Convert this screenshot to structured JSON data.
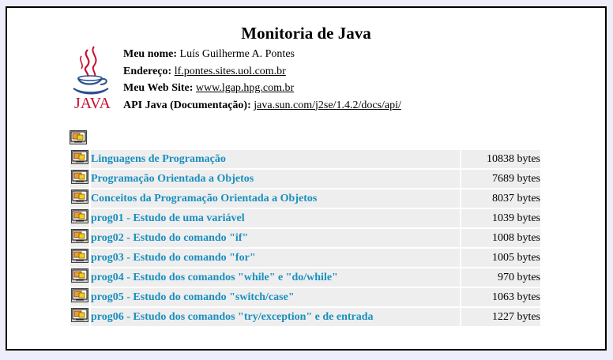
{
  "page": {
    "title": "Monitoria de Java"
  },
  "logo": {
    "word": "JAVA",
    "icon": "java-coffee-cup-logo"
  },
  "info": {
    "name_label": "Meu nome:",
    "name_value": "Luís Guilherme A. Pontes",
    "address_label": "Endereço:",
    "address_value": "lf.pontes.sites.uol.com.br",
    "website_label": "Meu Web Site:",
    "website_value": "www.lgap.hpg.com.br",
    "api_label": "API Java (Documentação):",
    "api_value": "java.sun.com/j2se/1.4.2/docs/api/"
  },
  "files": [
    {
      "name": "Linguagens de Programação",
      "size": "10838 bytes"
    },
    {
      "name": "Programação Orientada a Objetos",
      "size": "7689 bytes"
    },
    {
      "name": "Conceitos da Programação Orientada a Objetos",
      "size": "8037 bytes"
    },
    {
      "name": "prog01 - Estudo de uma variável",
      "size": "1039 bytes"
    },
    {
      "name": "prog02 - Estudo do comando \"if\"",
      "size": "1008 bytes"
    },
    {
      "name": "prog03 - Estudo do comando \"for\"",
      "size": "1005 bytes"
    },
    {
      "name": "prog04 - Estudo dos comandos \"while\" e \"do/while\"",
      "size": "970 bytes"
    },
    {
      "name": "prog05 - Estudo do comando \"switch/case\"",
      "size": "1063 bytes"
    },
    {
      "name": "prog06 - Estudo dos comandos \"try/exception\" e de entrada",
      "size": "1227 bytes"
    }
  ],
  "colors": {
    "background": "#eeeefa",
    "link": "#1a8fbf",
    "row": "#eeeeee",
    "java_red": "#c8102e"
  },
  "icons": {
    "file": "presentation-file-icon"
  }
}
